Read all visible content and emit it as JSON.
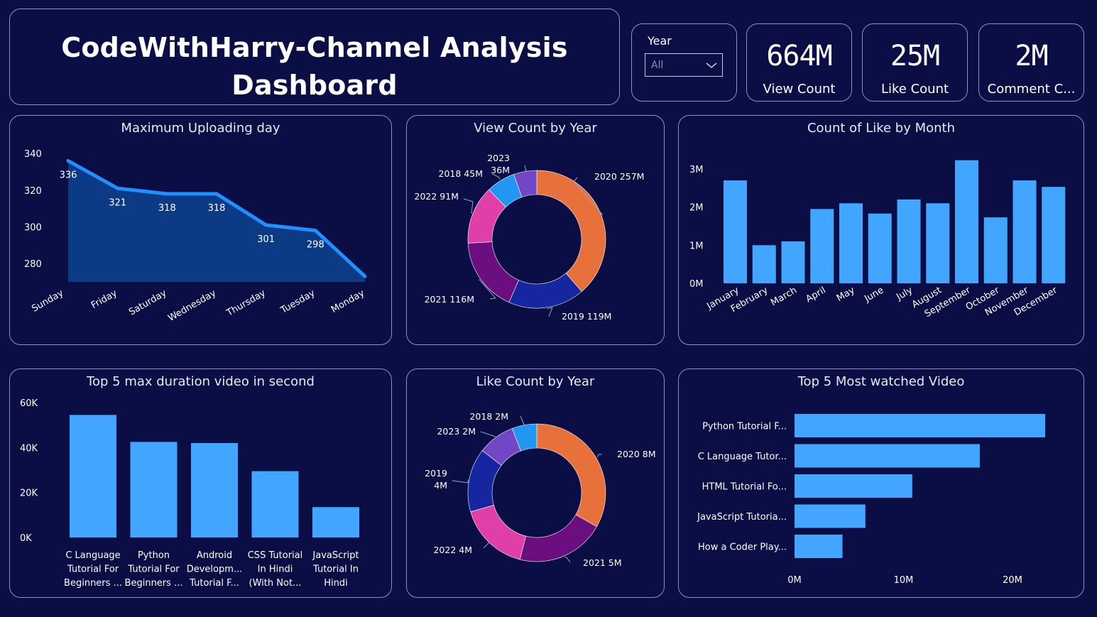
{
  "header": {
    "title_line1": "CodeWithHarry-Channel Analysis",
    "title_line2": "Dashboard"
  },
  "slicer": {
    "label": "Year",
    "value": "All"
  },
  "kpis": [
    {
      "value": "664M",
      "caption": "View Count"
    },
    {
      "value": "25M",
      "caption": "Like Count"
    },
    {
      "value": "2M",
      "caption": "Comment C..."
    }
  ],
  "colors": {
    "background": "#0a0e44",
    "bar": "#42a5ff",
    "area": "#0d3a84",
    "line": "#1e90ff",
    "donut": {
      "orange": "#e8703a",
      "navy": "#1526a0",
      "purple": "#6a0e80",
      "pink": "#e03fa8",
      "blue": "#2196f3",
      "violet": "#7147c5"
    }
  },
  "chart_data": [
    {
      "id": "uploading",
      "type": "area",
      "title": "Maximum Uploading day",
      "categories": [
        "Sunday",
        "Friday",
        "Saturday",
        "Wednesday",
        "Thursday",
        "Tuesday",
        "Monday"
      ],
      "values": [
        336,
        321,
        318,
        318,
        301,
        298,
        273
      ],
      "data_labels": [
        "336",
        "321",
        "318",
        "318",
        "301",
        "298",
        ""
      ],
      "yticks": [
        "280",
        "300",
        "320",
        "340"
      ],
      "ylim": [
        270,
        342
      ],
      "grid": false
    },
    {
      "id": "viewyear",
      "type": "pie",
      "title": "View Count by Year",
      "slices": [
        {
          "label": "2020 257M",
          "value": 257,
          "color": "#e8703a"
        },
        {
          "label": "2019 119M",
          "value": 119,
          "color": "#1526a0"
        },
        {
          "label": "2021 116M",
          "value": 116,
          "color": "#6a0e80"
        },
        {
          "label": "2022 91M",
          "value": 91,
          "color": "#e03fa8"
        },
        {
          "label": "2018 45M",
          "value": 45,
          "color": "#2196f3"
        },
        {
          "label": "2023 36M",
          "value": 36,
          "color": "#7147c5"
        }
      ]
    },
    {
      "id": "likemonth",
      "type": "bar",
      "title": "Count of Like by Month",
      "categories": [
        "January",
        "February",
        "March",
        "April",
        "May",
        "June",
        "July",
        "August",
        "September",
        "October",
        "November",
        "December"
      ],
      "values": [
        2.7,
        1.0,
        1.1,
        1.95,
        2.1,
        1.83,
        2.2,
        2.1,
        3.23,
        1.73,
        2.7,
        2.53
      ],
      "yticks": [
        "0M",
        "1M",
        "2M",
        "3M"
      ],
      "ylim": [
        0,
        3
      ],
      "grid": false
    },
    {
      "id": "duration",
      "type": "bar",
      "title": "Top 5 max duration video in second",
      "categories": [
        [
          "C Language",
          "Tutorial For",
          "Beginners ..."
        ],
        [
          "Python",
          "Tutorial For",
          "Beginners ..."
        ],
        [
          "Android",
          "Developm...",
          "Tutorial F..."
        ],
        [
          "CSS Tutorial",
          "In Hindi",
          "(With Not..."
        ],
        [
          "JavaScript",
          "Tutorial In",
          "Hindi"
        ]
      ],
      "values": [
        54500,
        42500,
        42000,
        29500,
        13500
      ],
      "yticks": [
        "0K",
        "20K",
        "40K",
        "60K"
      ],
      "ylim": [
        0,
        60000
      ],
      "grid": false
    },
    {
      "id": "likeyear",
      "type": "pie",
      "title": "Like Count by Year",
      "slices": [
        {
          "label": "2020 8M",
          "value": 8,
          "color": "#e8703a"
        },
        {
          "label": "2021 5M",
          "value": 5,
          "color": "#6a0e80"
        },
        {
          "label": "2022 4M",
          "value": 4,
          "color": "#e03fa8"
        },
        {
          "label": "2019 4M",
          "value": 3.6,
          "color": "#1526a0"
        },
        {
          "label": "2023 2M",
          "value": 2.1,
          "color": "#7147c5"
        },
        {
          "label": "2018 2M",
          "value": 1.4,
          "color": "#2196f3"
        }
      ]
    },
    {
      "id": "topwatched",
      "type": "bar",
      "orientation": "horizontal",
      "title": "Top 5 Most watched Video",
      "categories": [
        "Python Tutorial F...",
        "C Language Tutor...",
        "HTML Tutorial Fo...",
        "JavaScript Tutoria...",
        "How a Coder Play..."
      ],
      "values": [
        23,
        17,
        10.8,
        6.5,
        4.4
      ],
      "xticks": [
        "0M",
        "10M",
        "20M"
      ],
      "xlim": [
        0,
        20
      ],
      "grid": false
    }
  ]
}
